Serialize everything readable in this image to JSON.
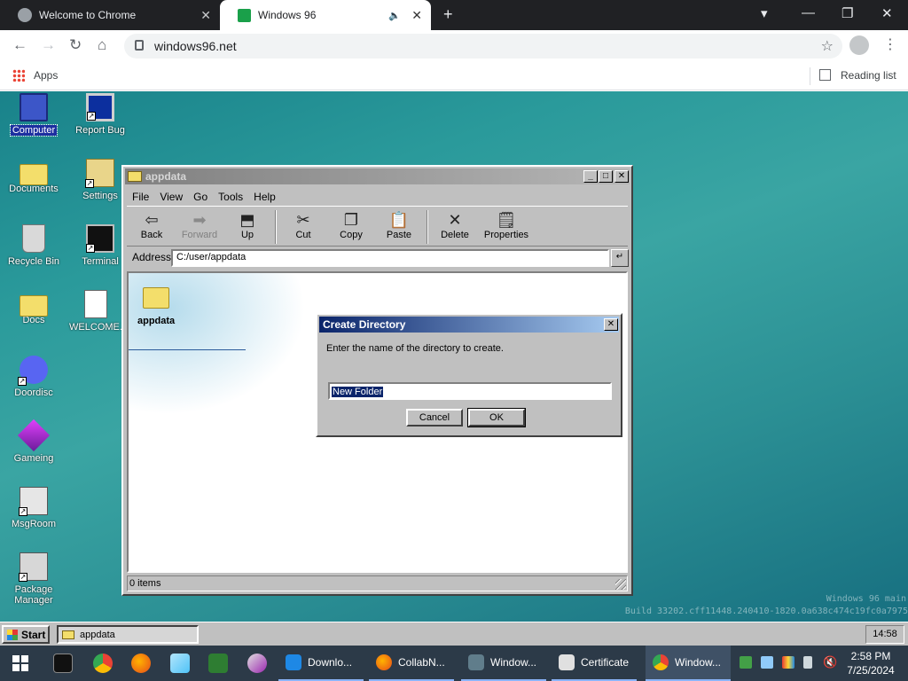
{
  "chrome": {
    "tabs": [
      {
        "title": "Welcome to Chrome"
      },
      {
        "title": "Windows 96"
      }
    ],
    "url": "windows96.net",
    "bookmarks": {
      "apps": "Apps",
      "reading_list": "Reading list"
    }
  },
  "desktop": {
    "icons": [
      {
        "label": "Computer"
      },
      {
        "label": "Report Bug"
      },
      {
        "label": "Documents"
      },
      {
        "label": "Settings"
      },
      {
        "label": "Recycle Bin"
      },
      {
        "label": "Terminal"
      },
      {
        "label": "Docs"
      },
      {
        "label": "WELCOME."
      },
      {
        "label": "Doordisc"
      },
      {
        "label": "Gameing"
      },
      {
        "label": "MsgRoom"
      },
      {
        "label": "Package Manager"
      }
    ],
    "watermark_line1": "Windows 96 main",
    "watermark_line2": "Build 33202.cff11448.240410-1820.0a638c474c19fc0a7975"
  },
  "explorer": {
    "title": "appdata",
    "menu": [
      "File",
      "View",
      "Go",
      "Tools",
      "Help"
    ],
    "toolbar": [
      {
        "label": "Back"
      },
      {
        "label": "Forward"
      },
      {
        "label": "Up"
      },
      {
        "label": "Cut"
      },
      {
        "label": "Copy"
      },
      {
        "label": "Paste"
      },
      {
        "label": "Delete"
      },
      {
        "label": "Properties"
      }
    ],
    "address_label": "Address",
    "address": "C:/user/appdata",
    "items": [
      {
        "name": "appdata"
      }
    ],
    "status": "0 items"
  },
  "dialog": {
    "title": "Create Directory",
    "prompt": "Enter the name of the directory to create.",
    "value": "New Folder",
    "cancel": "Cancel",
    "ok": "OK"
  },
  "w96_taskbar": {
    "start": "Start",
    "items": [
      {
        "label": "appdata"
      }
    ],
    "clock": "14:58"
  },
  "win_taskbar": {
    "apps": [
      {
        "label": "Downlo..."
      },
      {
        "label": "CollabN..."
      },
      {
        "label": "Window..."
      },
      {
        "label": "Certificate"
      },
      {
        "label": "Window..."
      }
    ],
    "time": "2:58 PM",
    "date": "7/25/2024"
  }
}
